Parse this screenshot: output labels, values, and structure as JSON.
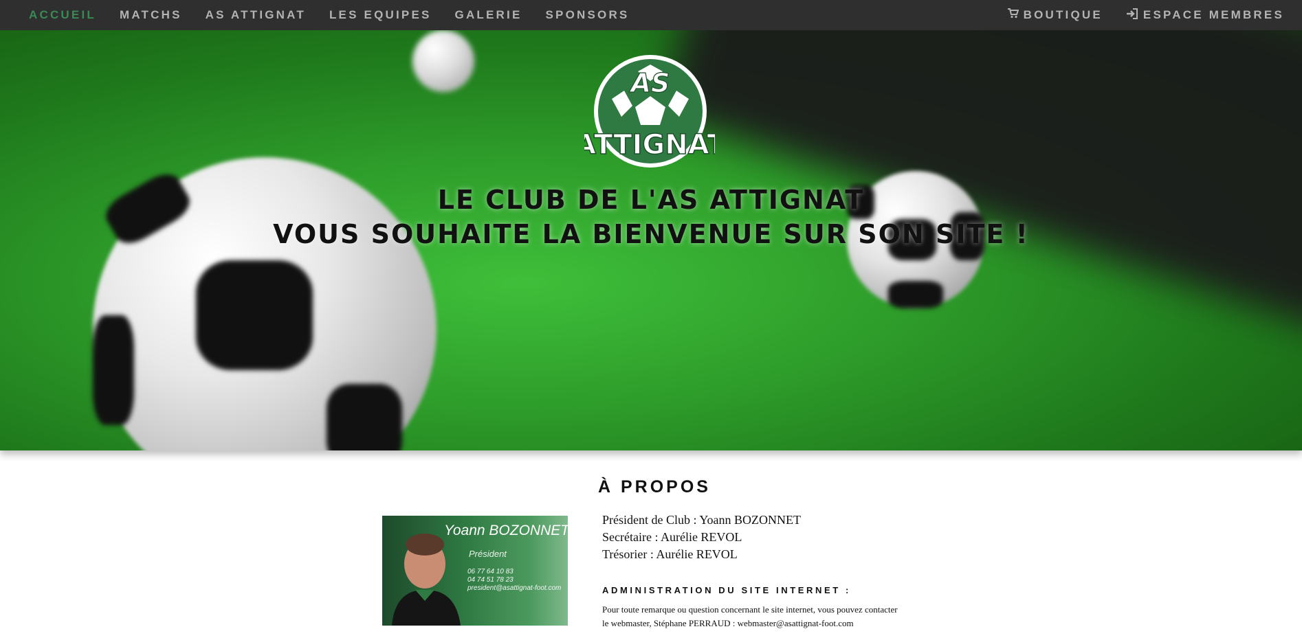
{
  "nav": {
    "left": [
      "ACCUEIL",
      "MATCHS",
      "AS ATTIGNAT",
      "LES EQUIPES",
      "GALERIE",
      "SPONSORS"
    ],
    "right": [
      {
        "label": "BOUTIQUE",
        "icon": "cart-icon"
      },
      {
        "label": "ESPACE MEMBRES",
        "icon": "sign-in-icon"
      }
    ],
    "active": "ACCUEIL"
  },
  "hero": {
    "logo_top": "AS",
    "logo_bottom": "ATTIGNAT",
    "title_line1": "LE CLUB DE L'AS ATTIGNAT",
    "title_line2": "VOUS SOUHAITE LA BIENVENUE SUR SON SITE !"
  },
  "about": {
    "heading": "À PROPOS",
    "card": {
      "name": "Yoann BOZONNET",
      "role": "Président",
      "phone1": "06 77 64 10 83",
      "phone2": "04 74 51 78 23",
      "email": "president@asattignat-foot.com"
    },
    "lines": [
      "Président de Club : Yoann BOZONNET",
      "Secrétaire : Aurélie REVOL",
      "Trésorier : Aurélie REVOL"
    ],
    "admin_heading": "ADMINISTRATION DU SITE INTERNET :",
    "admin_text_1": "Pour toute remarque ou question concernant le site internet, vous pouvez contacter",
    "admin_text_2": "le webmaster, Stéphane PERRAUD : webmaster@asattignat-foot.com"
  },
  "colors": {
    "navbar_bg": "#2f2f2f",
    "nav_text": "#b3b3b3",
    "nav_active": "#3a8a55",
    "club_green": "#2f7a43"
  }
}
